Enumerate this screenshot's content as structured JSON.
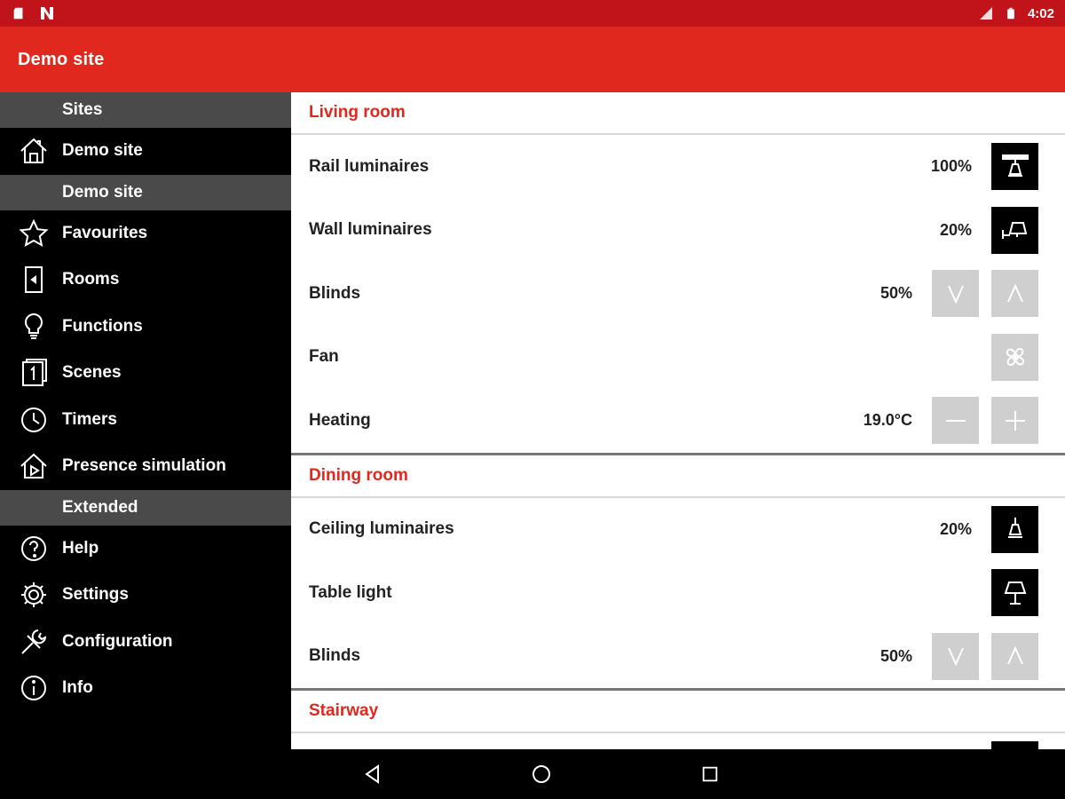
{
  "status": {
    "time": "4:02"
  },
  "appbar": {
    "title": "Demo site"
  },
  "drawer": {
    "sec_sites": "Sites",
    "site_name": "Demo site",
    "sec_demo": "Demo site",
    "favourites": "Favourites",
    "rooms": "Rooms",
    "functions": "Functions",
    "scenes": "Scenes",
    "timers": "Timers",
    "presence": "Presence simulation",
    "sec_extended": "Extended",
    "help": "Help",
    "settings": "Settings",
    "configuration": "Configuration",
    "info": "Info"
  },
  "rooms": {
    "living": {
      "title": "Living room",
      "rail": {
        "label": "Rail luminaires",
        "value": "100%"
      },
      "wall": {
        "label": "Wall luminaires",
        "value": "20%"
      },
      "blinds": {
        "label": "Blinds",
        "value": "50%"
      },
      "fan": {
        "label": "Fan"
      },
      "heating": {
        "label": "Heating",
        "value": "19.0°C"
      }
    },
    "dining": {
      "title": "Dining room",
      "ceiling": {
        "label": "Ceiling luminaires",
        "value": "20%"
      },
      "table": {
        "label": "Table light"
      },
      "blinds": {
        "label": "Blinds",
        "value": "50%"
      }
    },
    "stairway": {
      "title": "Stairway"
    }
  },
  "colors": {
    "status": "#c0141a",
    "appbar": "#e0281f",
    "accent": "#e0281f",
    "section": "#4a4a4a"
  }
}
